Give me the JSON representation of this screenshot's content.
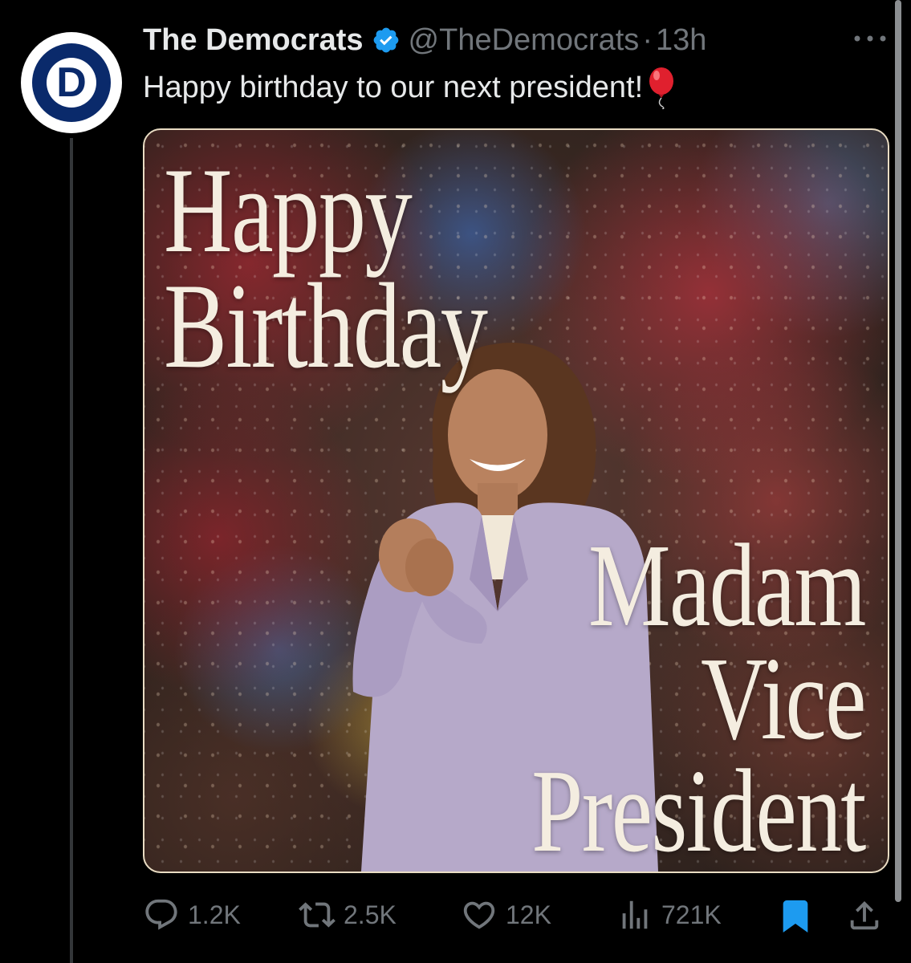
{
  "tweet": {
    "display_name": "The Democrats",
    "handle": "@TheDemocrats",
    "separator": "·",
    "time": "13h",
    "text": "Happy birthday to our next president!",
    "avatar_letter": "D"
  },
  "media": {
    "headline_lines": [
      "Happy",
      "Birthday"
    ],
    "subtitle_lines": [
      "Madam",
      "Vice",
      "President"
    ]
  },
  "actions": {
    "replies": "1.2K",
    "reposts": "2.5K",
    "likes": "12K",
    "views": "721K"
  },
  "colors": {
    "background": "#000000",
    "primary_text": "#e7e9ea",
    "secondary_text": "#71767b",
    "verified_blue": "#1d9bf0",
    "bookmark_active": "#1d9bf0",
    "avatar_navy": "#0a2a6b"
  },
  "icons": {
    "verified": "verified-badge-icon",
    "more": "more-dots-icon",
    "reply": "reply-icon",
    "repost": "repost-icon",
    "like": "heart-icon",
    "views": "views-chart-icon",
    "bookmark": "bookmark-icon",
    "share": "share-icon"
  }
}
